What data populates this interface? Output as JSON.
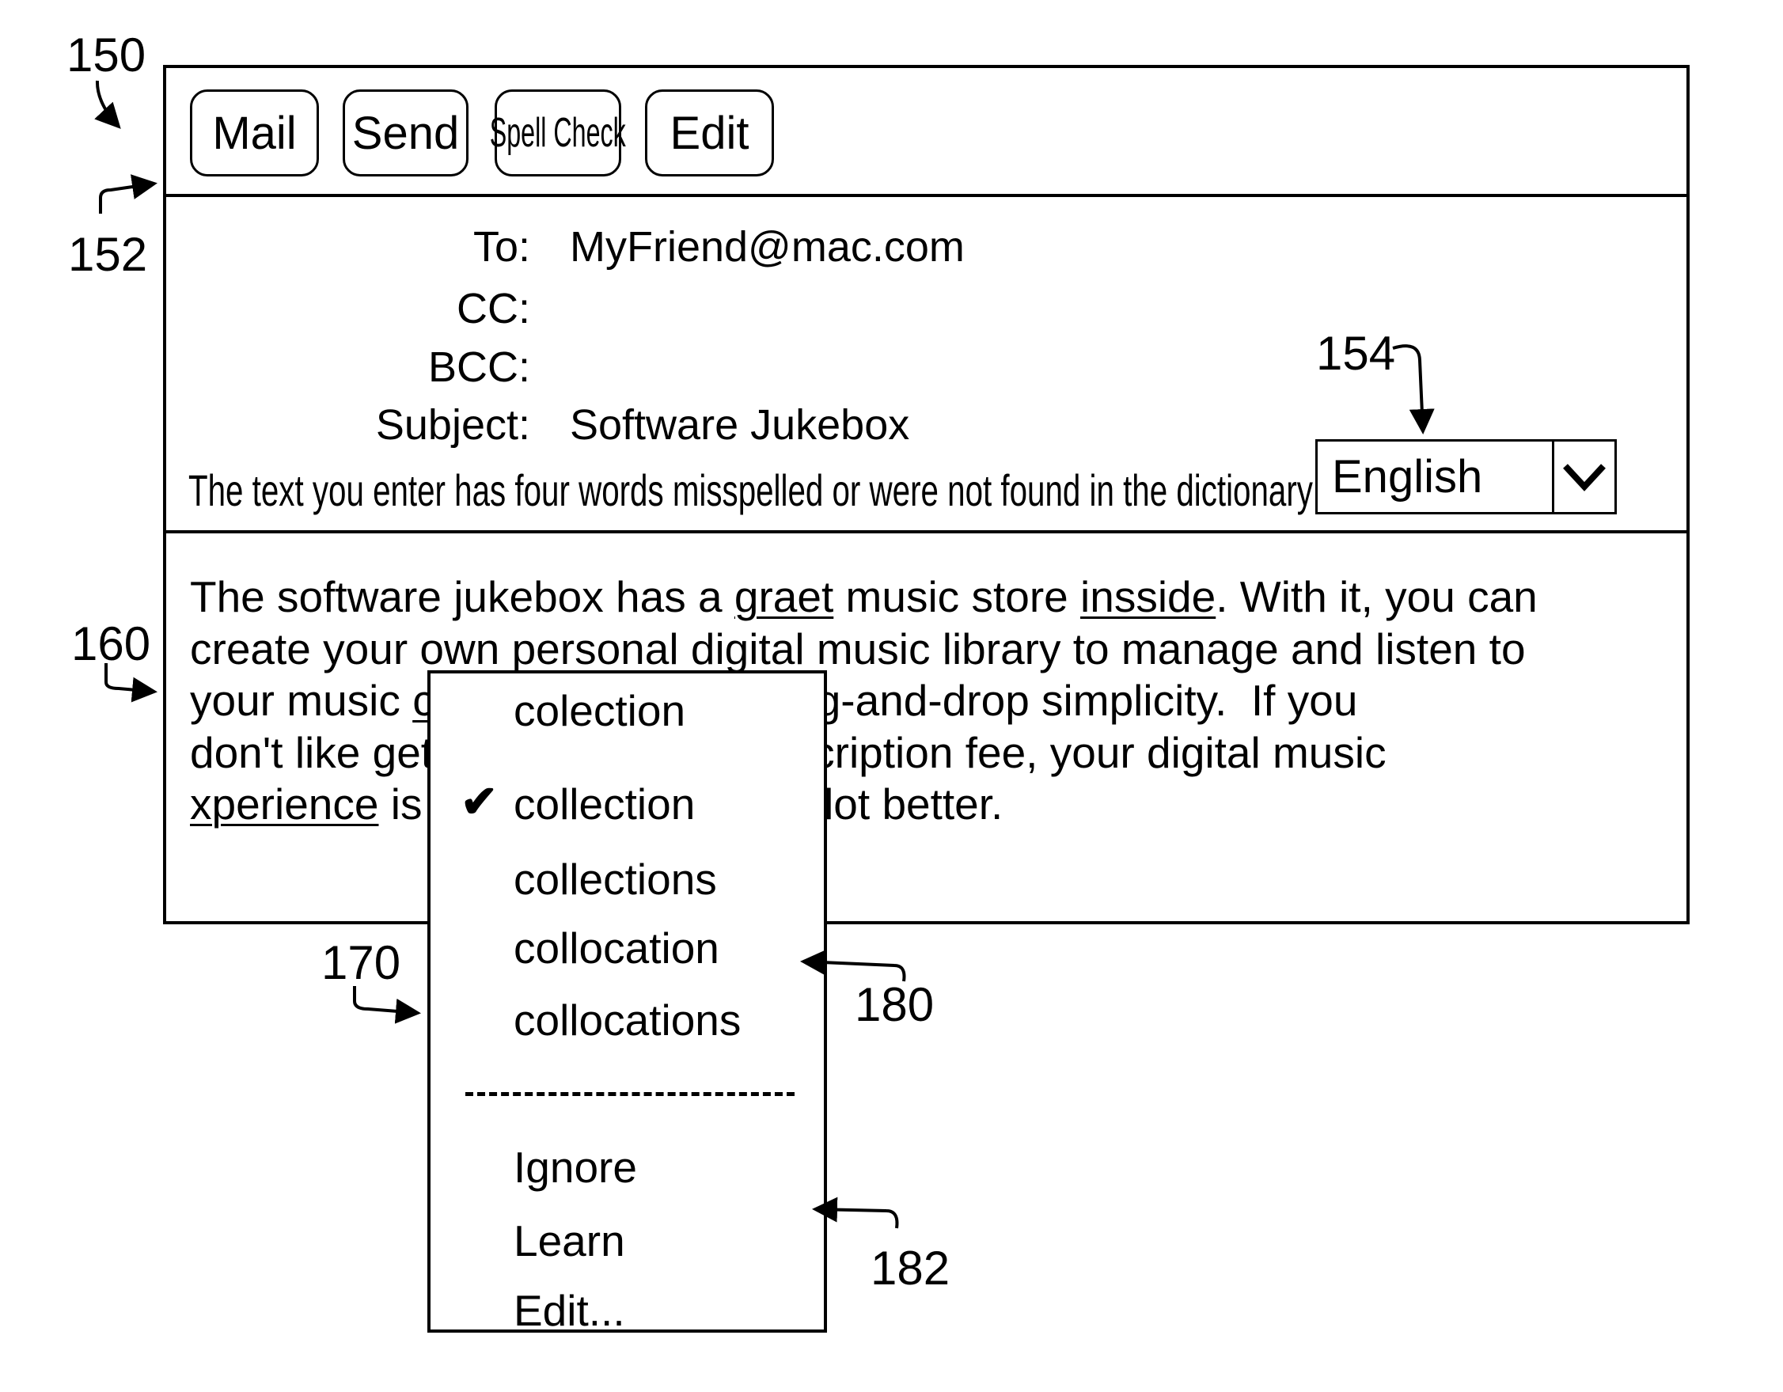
{
  "window": {
    "reference_number": "150"
  },
  "toolbar": {
    "reference_number": "152",
    "buttons": [
      {
        "label": "Mail",
        "icon": null
      },
      {
        "label": "Send",
        "icon": null
      },
      {
        "label": "Spell Check",
        "icon": null
      },
      {
        "label": "Edit",
        "icon": null
      }
    ]
  },
  "header": {
    "to_label": "To:",
    "to_value": "MyFriend@mac.com",
    "cc_label": "CC:",
    "cc_value": "",
    "bcc_label": "BCC:",
    "bcc_value": "",
    "subject_label": "Subject:",
    "subject_value": "Software Jukebox",
    "spell_message": "The text you enter has four words misspelled or were not found in the dictionary",
    "language": {
      "reference_number": "154",
      "selected": "English",
      "icon": "chevron-down-icon"
    }
  },
  "body": {
    "reference_number": "160",
    "lines": [
      {
        "segments": [
          {
            "text": "The software jukebox has a ",
            "misspelled": false
          },
          {
            "text": "graet",
            "misspelled": true
          },
          {
            "text": " music store ",
            "misspelled": false
          },
          {
            "text": "insside",
            "misspelled": true
          },
          {
            "text": ". With it, you can",
            "misspelled": false
          }
        ]
      },
      {
        "segments": [
          {
            "text": "create your own personal digital music library to manage and listen to",
            "misspelled": false
          }
        ]
      },
      {
        "segments": [
          {
            "text": "your music ",
            "misspelled": false
          },
          {
            "text": "colection",
            "misspelled": true
          },
          {
            "text": ", all with drag-and-drop simplicity.  If you",
            "misspelled": false
          }
        ]
      },
      {
        "segments": [
          {
            "text": "don't like getting charged a subscription fee, your digital music",
            "misspelled": false
          }
        ]
      },
      {
        "segments": [
          {
            "text": "xperience",
            "misspelled": true
          },
          {
            "text": " is going to be a whole lot better.",
            "misspelled": false
          }
        ]
      }
    ]
  },
  "context_menu": {
    "reference_number": "170",
    "suggestions_reference_number": "180",
    "actions_reference_number": "182",
    "original_word": "colection",
    "suggestions": [
      {
        "label": "collection",
        "checked": true
      },
      {
        "label": "collections",
        "checked": false
      },
      {
        "label": "collocation",
        "checked": false
      },
      {
        "label": "collocations",
        "checked": false
      }
    ],
    "check_glyph": "✔",
    "separator": "- - - - - - - - - - - -",
    "actions": [
      {
        "label": "Ignore"
      },
      {
        "label": "Learn"
      },
      {
        "label": "Edit..."
      }
    ]
  }
}
